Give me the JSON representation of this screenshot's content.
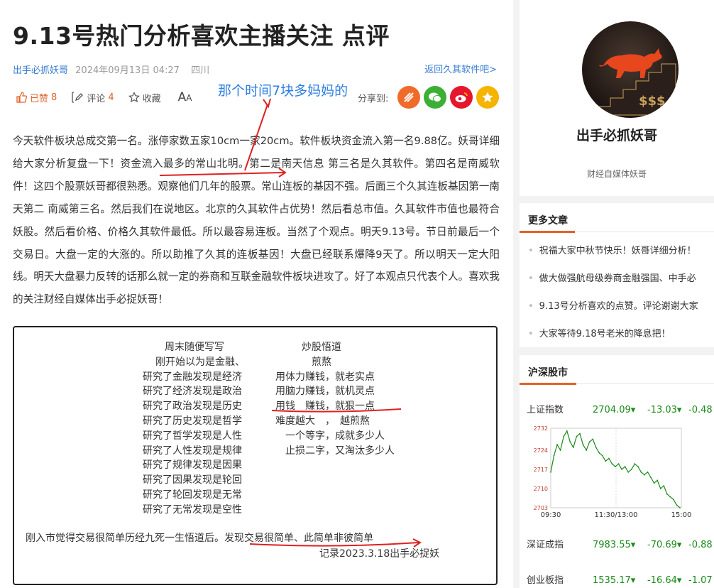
{
  "article": {
    "title": "9.13号热门分析喜欢主播关注 点评",
    "author": "出手必抓妖哥",
    "date": "2024年09月13日 04:27",
    "location": "四川",
    "back_link": "返回久其软件吧>",
    "actions": {
      "like_label": "已赞",
      "like_count": "8",
      "comment_label": "评论",
      "comment_count": "4",
      "favorite_label": "收藏",
      "font_label": "A",
      "font_label_small": "A"
    },
    "annotation": "那个时间7块多妈妈的",
    "share_label": "分享到:",
    "body": "今天软件板块总成交第一名。涨停家数五家10cm一家20cm。软件板块资金流入第一名9.88亿。妖哥详细给大家分析复盘一下！资金流入最多的常山北明。第二是南天信息 第三名是久其软件。第四名是南威软件！这四个股票妖哥都很熟悉。观察他们几年的股票。常山连板的基因不强。后面三个久其连板基因第一南天第二 南威第三名。然后我们在说地区。北京的久其软件占优势！然后看总市值。久其软件市值也最符合妖股。然后看价格、价格久其软件最低。所以最容易连板。当然了个观点。明天9.13号。节日前最后一个交易日。大盘一定的大涨的。所以助推了久其的连板基因！大盘已经联系爆降9天了。所以明天一定大阳线。明天大盘暴力反转的话那么就一定的券商和互联金融软件板块进攻了。好了本观点只代表个人。喜欢我的关注财经自媒体出手必捉妖哥！"
  },
  "notes": {
    "col1_title": "周末随便写写",
    "col1_intro": "刚开始以为是金融、",
    "col1_lines": [
      "研究了金融发现是经济",
      "研究了经济发现是政治",
      "研究了政治发现是历史",
      "研究了历史发现是哲学",
      "研究了哲学发现是人性",
      "研究了人性发现是规律",
      "研究了规律发现是因果",
      "研究了因果发现是轮回",
      "研究了轮回发现是无常",
      "研究了无常发现是空性"
    ],
    "col2_title": "炒股悟道",
    "col2_sub": "煎熬",
    "col2_lines": [
      "用体力赚钱，就老实点",
      "用脑力赚钱，就机灵点",
      "用钱　赚钱，就狠一点",
      "难度越大　，　越煎熬",
      "　一个等字，成就多少人",
      "　止损二字，又淘汰多少人"
    ],
    "summary": "刚入市觉得交易很简单历经九死一生悟道后。发现交易很简单、此简单非彼简单",
    "signature": "记录2023.3.18出手必捉妖"
  },
  "profile": {
    "name": "出手必抓妖哥",
    "desc": "财经自媒体妖哥"
  },
  "more_articles": {
    "title": "更多文章",
    "items": [
      "祝福大家中秋节快乐！妖哥详细分析！",
      "做大做强航母级券商金融强国、中手必",
      "9.13号分析喜欢的点赞。评论谢谢大家",
      "大家等待9.18号老米的降息把！"
    ]
  },
  "stocks": {
    "title": "沪深股市",
    "rows": [
      {
        "name": "上证指数",
        "price": "2704.09▾",
        "change": "-13.03▾",
        "pct": "-0.48"
      },
      {
        "name": "深证成指",
        "price": "7983.55▾",
        "change": "-70.69▾",
        "pct": "-0.88"
      },
      {
        "name": "创业板指",
        "price": "1535.17▾",
        "change": "-16.64▾",
        "pct": "-1.07"
      }
    ]
  },
  "chart_data": {
    "type": "line",
    "title": "",
    "xlabel": "",
    "ylabel": "",
    "x_ticks": [
      "09:30",
      "11:30/13:00",
      "15:00"
    ],
    "y_ticks": [
      2703,
      2710,
      2717,
      2724,
      2732
    ],
    "ylim": [
      2703,
      2732
    ],
    "series": [
      {
        "values": [
          2716,
          2722,
          2726,
          2724,
          2729,
          2731,
          2727,
          2725,
          2729,
          2730,
          2726,
          2724,
          2727,
          2728,
          2725,
          2723,
          2722,
          2720,
          2721,
          2719,
          2718,
          2719,
          2717,
          2718,
          2716,
          2717,
          2719,
          2718,
          2716,
          2715,
          2716,
          2714,
          2712,
          2713,
          2710,
          2711,
          2708,
          2707,
          2706,
          2704,
          2703
        ]
      }
    ],
    "colors": {
      "line": "#1a8a1a",
      "volume": "#1a8a1a",
      "accent": "#e0622a"
    }
  }
}
